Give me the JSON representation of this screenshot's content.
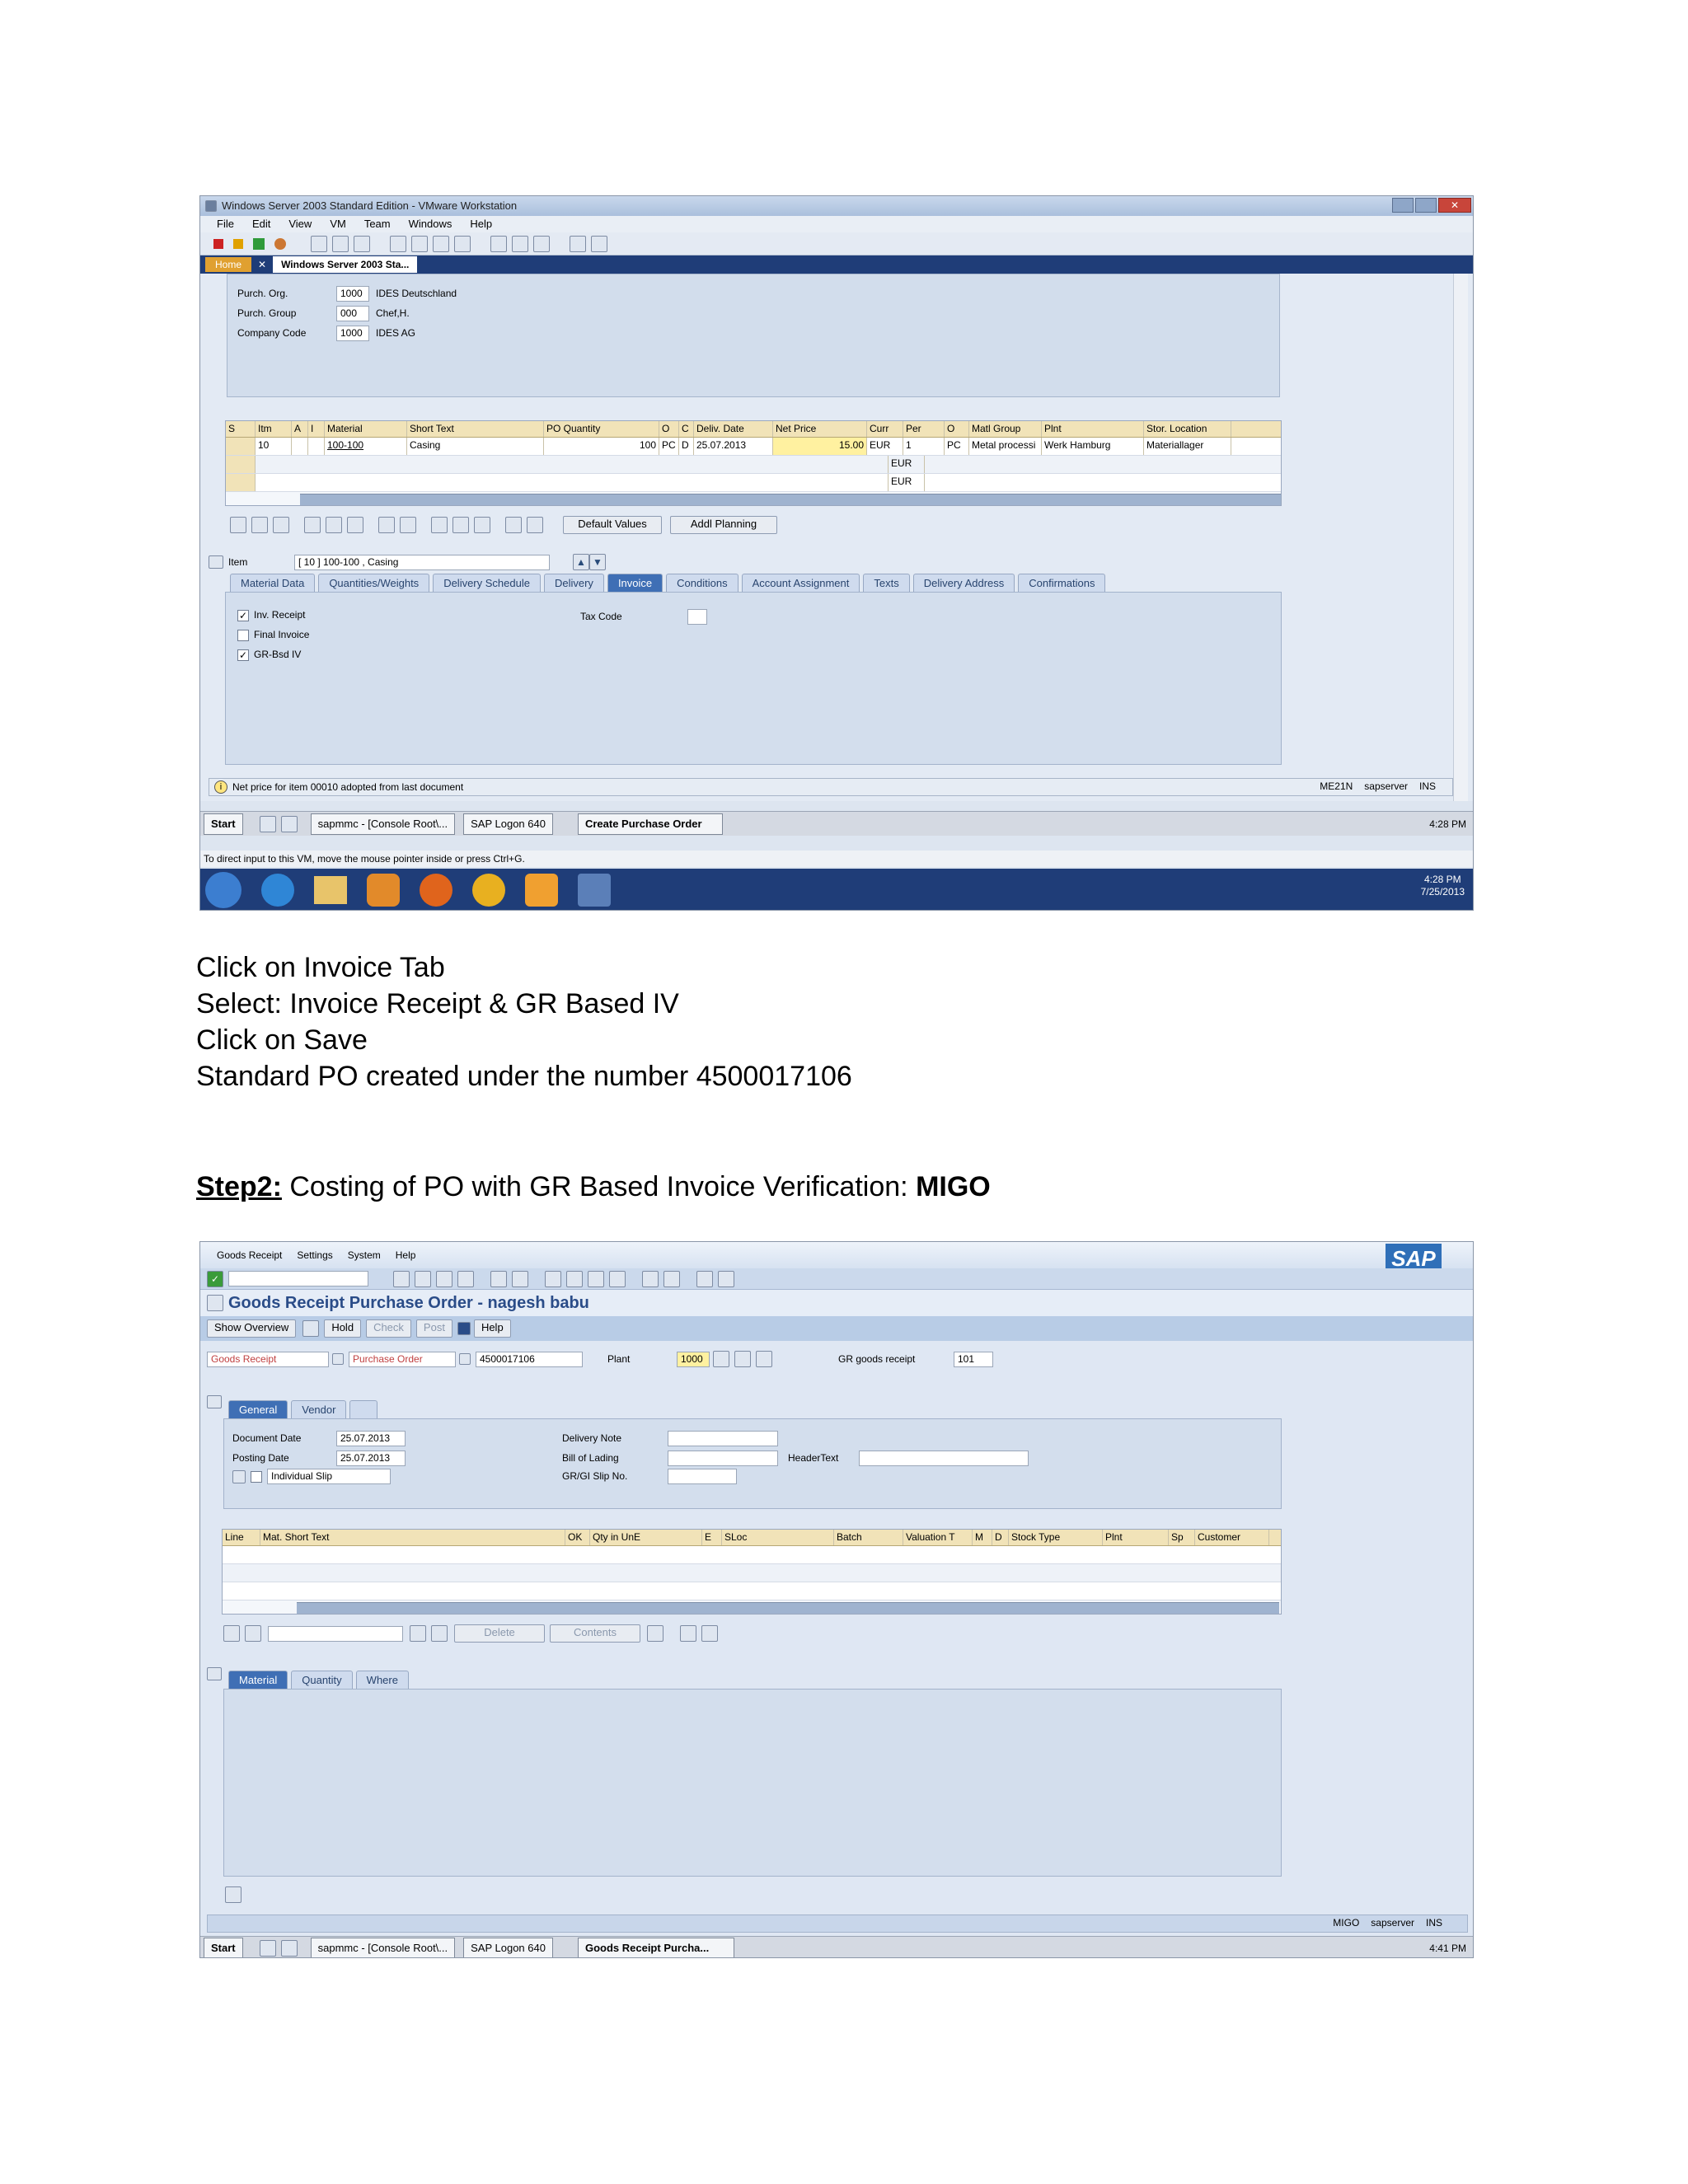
{
  "shot1": {
    "vm_title": "Windows Server 2003 Standard Edition - VMware Workstation",
    "vm_menu": [
      "File",
      "Edit",
      "View",
      "VM",
      "Team",
      "Windows",
      "Help"
    ],
    "vm_tabs": {
      "home": "Home",
      "active": "Windows Server 2003 Sta..."
    },
    "org": [
      {
        "label": "Purch. Org.",
        "code": "1000",
        "desc": "IDES Deutschland"
      },
      {
        "label": "Purch. Group",
        "code": "000",
        "desc": "Chef,H."
      },
      {
        "label": "Company Code",
        "code": "1000",
        "desc": "IDES AG"
      }
    ],
    "item_grid": {
      "columns": [
        "S",
        "Itm",
        "A",
        "I",
        "Material",
        "Short Text",
        "PO Quantity",
        "O",
        "C",
        "Deliv. Date",
        "Net Price",
        "Curr",
        "Per",
        "O",
        "Matl Group",
        "Plnt",
        "Stor. Location"
      ],
      "rows": [
        {
          "itm": "10",
          "material": "100-100",
          "short_text": "Casing",
          "po_qty": "100",
          "unit": "PC",
          "c": "D",
          "deliv_date": "25.07.2013",
          "net_price": "15.00",
          "curr": "EUR",
          "per": "1",
          "o": "PC",
          "matl_group": "Metal processi",
          "plnt": "Werk Hamburg",
          "stor_loc": "Materiallager"
        },
        {
          "curr": "EUR"
        },
        {
          "curr": "EUR"
        }
      ]
    },
    "buttons": {
      "default_values": "Default Values",
      "addl_planning": "Addl Planning"
    },
    "item_selector": {
      "label": "Item",
      "value": "[ 10 ] 100-100 , Casing"
    },
    "detail_tabs": [
      "Material Data",
      "Quantities/Weights",
      "Delivery Schedule",
      "Delivery",
      "Invoice",
      "Conditions",
      "Account Assignment",
      "Texts",
      "Delivery Address",
      "Confirmations"
    ],
    "invoice_fields": {
      "inv_receipt": "Inv. Receipt",
      "final_invoice": "Final Invoice",
      "gr_based_iv": "GR-Bsd IV",
      "tax_code": "Tax Code"
    },
    "status_msg": "Net price for item 00010 adopted from last document",
    "status_right": {
      "tcode": "ME21N",
      "server": "sapserver",
      "mode": "INS"
    },
    "guest_taskbar": {
      "start": "Start",
      "items": [
        "sapmmc - [Console Root\\...",
        "SAP Logon 640",
        "Create Purchase Order"
      ],
      "time": "4:28 PM"
    },
    "vm_hint": "To direct input to this VM, move the mouse pointer inside or press Ctrl+G.",
    "host_clock": {
      "time": "4:28 PM",
      "date": "7/25/2013"
    }
  },
  "instructions": [
    "Click on Invoice Tab",
    "Select: Invoice Receipt & GR Based IV",
    "Click on Save",
    "Standard PO created under the number 4500017106"
  ],
  "step2": {
    "label": "Step2:",
    "text": " Costing of PO with GR Based Invoice Verification: ",
    "tcode": "MIGO"
  },
  "shot2": {
    "menu": [
      "Goods Receipt",
      "Settings",
      "System",
      "Help"
    ],
    "title": "Goods Receipt Purchase Order - nagesh babu",
    "logo": "SAP",
    "app_buttons": [
      "Show Overview",
      "Hold",
      "Check",
      "Post",
      "Help"
    ],
    "action": "Goods Receipt",
    "ref_doc": "Purchase Order",
    "po_number": "4500017106",
    "plant_label": "Plant",
    "plant_value": "1000",
    "gr_label": "GR goods receipt",
    "gr_value": "101",
    "header_tabs": [
      "General",
      "Vendor"
    ],
    "header": {
      "doc_date_label": "Document Date",
      "doc_date": "25.07.2013",
      "post_date_label": "Posting Date",
      "post_date": "25.07.2013",
      "slip": "Individual Slip",
      "delivery_note": "Delivery Note",
      "bill_of_lading": "Bill of Lading",
      "gr_gi_slip": "GR/GI Slip No.",
      "header_text": "HeaderText"
    },
    "item_grid": {
      "columns": [
        "Line",
        "Mat. Short Text",
        "OK",
        "Qty in UnE",
        "E",
        "SLoc",
        "Batch",
        "Valuation T",
        "M",
        "D",
        "Stock Type",
        "Plnt",
        "Sp",
        "Customer"
      ]
    },
    "grid_buttons": {
      "delete": "Delete",
      "contents": "Contents"
    },
    "detail_tabs": [
      "Material",
      "Quantity",
      "Where"
    ],
    "status_right": {
      "tcode": "MIGO",
      "server": "sapserver",
      "mode": "INS"
    },
    "taskbar": {
      "start": "Start",
      "items": [
        "sapmmc - [Console Root\\...",
        "SAP Logon 640",
        "Goods Receipt Purcha..."
      ],
      "time": "4:41 PM"
    }
  },
  "colors": {
    "sap_blue": "#3f6fb5",
    "panel": "#dfe7f3",
    "header_yellow": "#f1e3b8",
    "taskbar": "#1f3d78"
  }
}
